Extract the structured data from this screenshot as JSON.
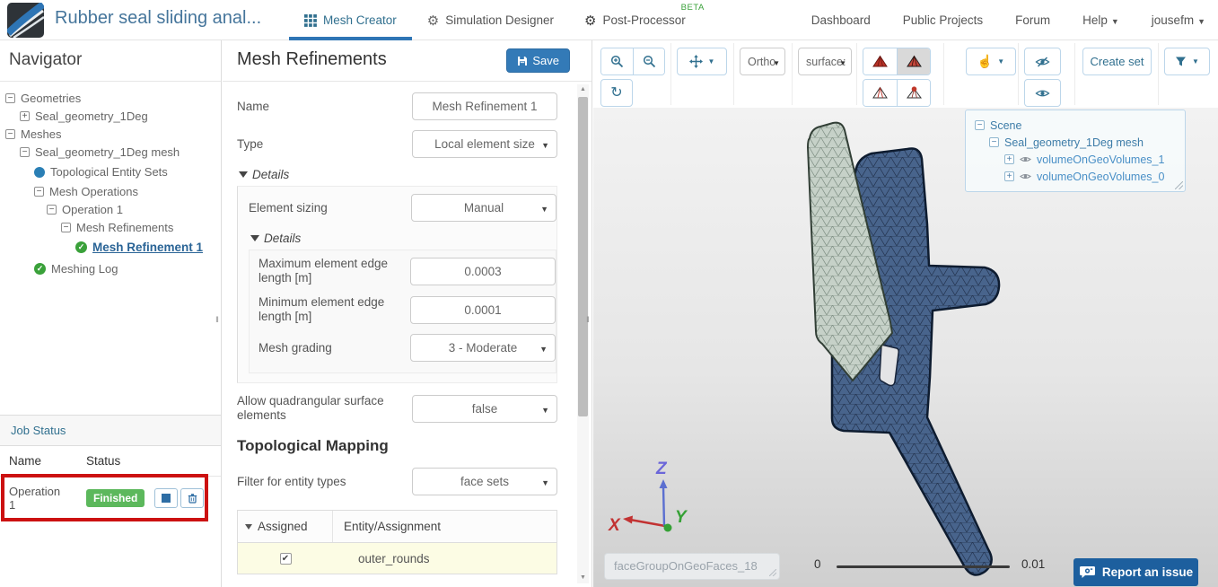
{
  "navbar": {
    "project_title": "Rubber seal sliding anal...",
    "tabs": [
      {
        "label": "Mesh Creator",
        "active": true
      },
      {
        "label": "Simulation Designer",
        "active": false
      },
      {
        "label": "Post-Processor",
        "active": false,
        "badge": "BETA"
      }
    ],
    "links": [
      "Dashboard",
      "Public Projects",
      "Forum"
    ],
    "help_label": "Help",
    "user_label": "jousefm"
  },
  "navigator": {
    "title": "Navigator",
    "tree": [
      {
        "label": "Geometries",
        "glyph": "collapse"
      },
      {
        "label": "Seal_geometry_1Deg",
        "glyph": "expand"
      },
      {
        "label": "Meshes",
        "glyph": "collapse"
      },
      {
        "label": "Seal_geometry_1Deg mesh",
        "glyph": "collapse"
      },
      {
        "label": "Topological Entity Sets",
        "glyph": "dot"
      },
      {
        "label": "Mesh Operations",
        "glyph": "collapse"
      },
      {
        "label": "Operation 1",
        "glyph": "collapse"
      },
      {
        "label": "Mesh Refinements",
        "glyph": "collapse"
      },
      {
        "label": "Mesh Refinement 1",
        "glyph": "check",
        "selected": true
      },
      {
        "label": "Meshing Log",
        "glyph": "check"
      }
    ]
  },
  "job_status": {
    "title": "Job Status",
    "columns": [
      "Name",
      "Status"
    ],
    "rows": [
      {
        "name": "Operation 1",
        "status": "Finished"
      }
    ]
  },
  "properties": {
    "title": "Mesh Refinements",
    "save_label": "Save",
    "fields": {
      "name_label": "Name",
      "name_value": "Mesh Refinement 1",
      "type_label": "Type",
      "type_value": "Local element size",
      "details_label": "Details",
      "element_sizing_label": "Element sizing",
      "element_sizing_value": "Manual",
      "inner_details_label": "Details",
      "max_edge_label": "Maximum element edge length [m]",
      "max_edge_value": "0.0003",
      "min_edge_label": "Minimum element edge length [m]",
      "min_edge_value": "0.0001",
      "mesh_grading_label": "Mesh grading",
      "mesh_grading_value": "3 - Moderate",
      "quad_label": "Allow quadrangular surface elements",
      "quad_value": "false"
    },
    "topological_mapping": {
      "title": "Topological Mapping",
      "filter_label": "Filter for entity types",
      "filter_value": "face sets",
      "table": {
        "col_assigned": "Assigned",
        "col_entity": "Entity/Assignment",
        "rows": [
          {
            "checked": true,
            "entity": "outer_rounds"
          }
        ]
      }
    }
  },
  "viewer": {
    "toolbar": {
      "ortho": "Ortho",
      "render_mode": "surface:",
      "create_set": "Create set"
    },
    "scene_tree": {
      "root": "Scene",
      "mesh": "Seal_geometry_1Deg mesh",
      "volumes": [
        "volumeOnGeoVolumes_1",
        "volumeOnGeoVolumes_0"
      ]
    },
    "axis": {
      "x": "X",
      "y": "Y",
      "z": "Z"
    },
    "scale_bar": {
      "min": "0",
      "max": "0.01"
    },
    "selection_field": "faceGroupOnGeoFaces_18",
    "report_label": "Report an issue"
  },
  "colors": {
    "accent": "#31708f",
    "tab_underline": "#2e75b5",
    "save_button": "#337ab7",
    "finished_badge": "#5cb85c",
    "annotation": "#cc1111",
    "report_button": "#1d5f9e",
    "beta_badge": "#3aa13a",
    "axis_x": "#c23232",
    "axis_y": "#3aa13a",
    "axis_z": "#6b66d9",
    "mesh_dark_volume": "#48648c",
    "mesh_light_volume": "#c6d1c8"
  }
}
